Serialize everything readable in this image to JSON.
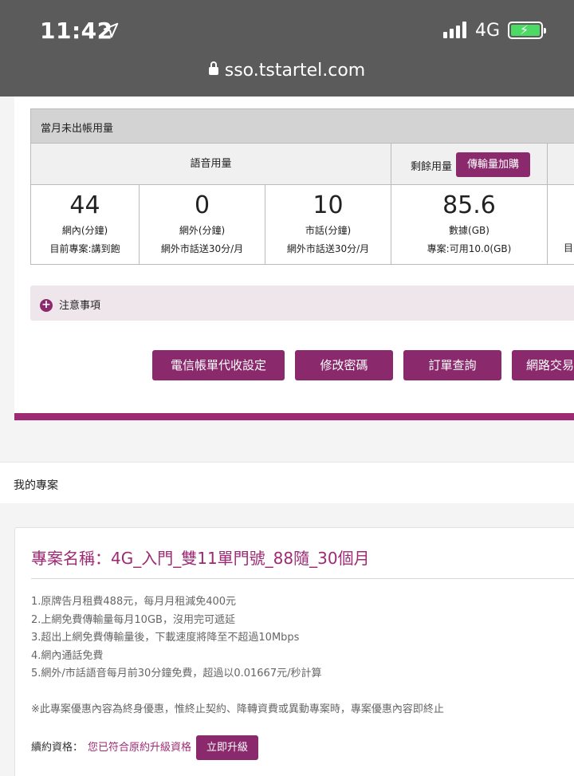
{
  "status_bar": {
    "time": "11:42",
    "network": "4G",
    "url": "sso.tstartel.com"
  },
  "usage": {
    "header": "當月未出帳用量",
    "voice_label": "語音用量",
    "remain_label": "剩餘用量",
    "addon_button": "傳輸量加購",
    "cells": [
      {
        "value": "44",
        "unit": "網內(分鐘)",
        "note": "目前專案:講到飽"
      },
      {
        "value": "0",
        "unit": "網外(分鐘)",
        "note": "網外市話送30分/月"
      },
      {
        "value": "10",
        "unit": "市話(分鐘)",
        "note": "網外市話送30分/月"
      },
      {
        "value": "85.6",
        "unit": "數據(GB)",
        "note": "專案:可用10.0(GB)"
      },
      {
        "note": "目"
      }
    ]
  },
  "notice": {
    "label": "注意事項"
  },
  "actions": [
    "電信帳單代收設定",
    "修改密碼",
    "訂單查詢",
    "網路交易"
  ],
  "my_plan": {
    "header": "我的專案",
    "title": "專案名稱：4G_入門_雙11單門號_88隨_30個月",
    "items": [
      "1.原牌告月租費488元，每月月租減免400元",
      "2.上網免費傳輸量每月10GB，沒用完可遞延",
      "3.超出上網免費傳輸量後，下載速度將降至不超過10Mbps",
      "4.網內通話免費",
      "5.網外/市話語音每月前30分鐘免費，超過以0.01667元/秒計算"
    ],
    "note": "※此專案優惠內容為終身優惠，惟終止契約、降轉資費或異動專案時，專案優惠內容即終止",
    "renew_label": "續約資格：",
    "renew_msg": "您已符合原約升級資格",
    "upgrade_button": "立即升級"
  },
  "colors": {
    "brand": "#8a2a6d",
    "accent_text": "#9e2a74",
    "battery": "#4cd964"
  }
}
